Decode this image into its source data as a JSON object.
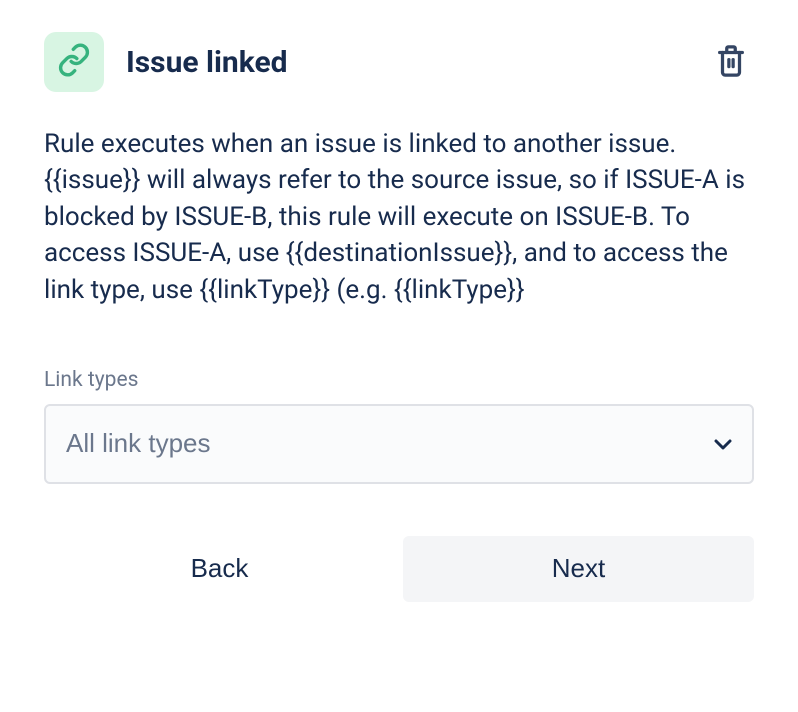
{
  "header": {
    "title": "Issue linked"
  },
  "description": "Rule executes when an issue is linked to another issue. {{issue}} will always refer to the source issue, so if ISSUE-A is blocked by ISSUE-B, this rule will execute on ISSUE-B. To access ISSUE-A, use {{destinationIssue}}, and to access the link type, use {{linkType}} (e.g. {{linkType}}",
  "form": {
    "link_types_label": "Link types",
    "link_types_value": "All link types"
  },
  "buttons": {
    "back": "Back",
    "next": "Next"
  }
}
